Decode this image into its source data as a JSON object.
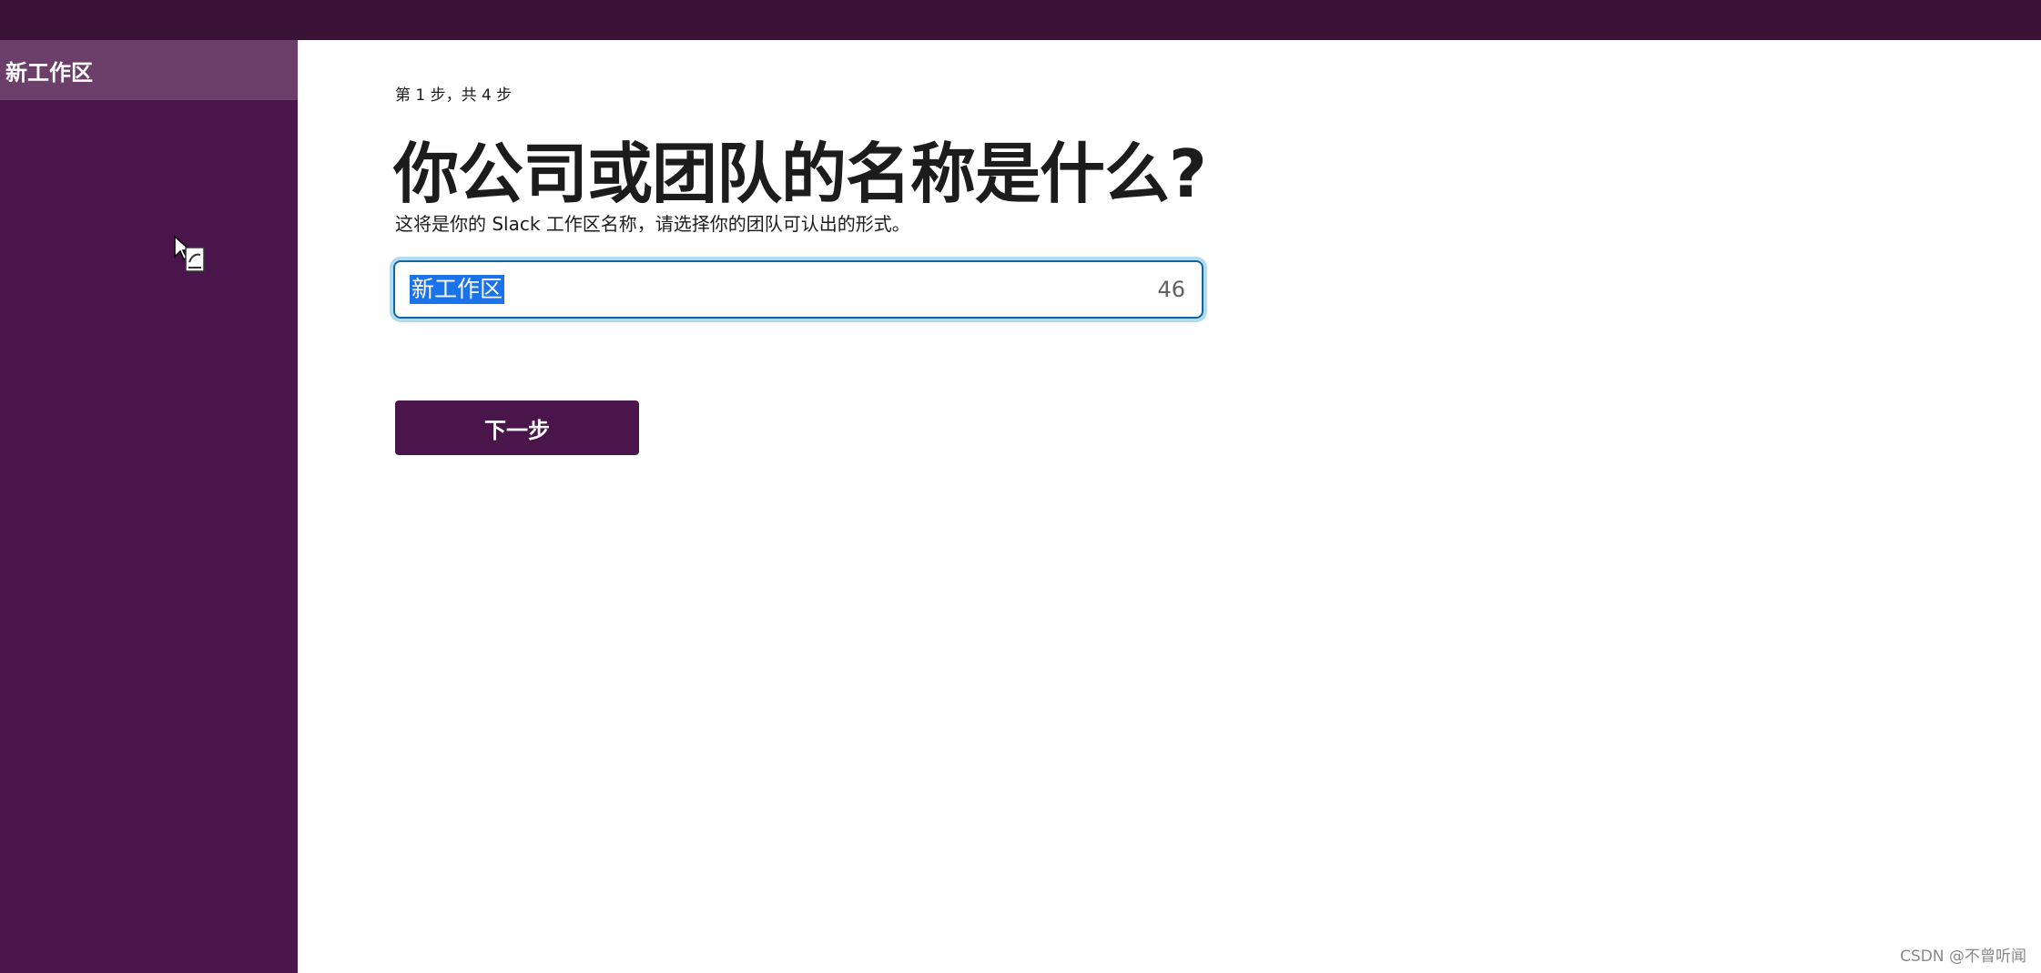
{
  "sidebar": {
    "workspace_name": "新工作区"
  },
  "main": {
    "step_text": "第 1 步，共 4 步",
    "heading": "你公司或团队的名称是什么?",
    "subtitle": "这将是你的 Slack 工作区名称，请选择你的团队可认出的形式。",
    "input": {
      "value": "新工作区",
      "remaining_count": "46"
    },
    "next_button_label": "下一步"
  },
  "watermark": "CSDN @不曾听闻",
  "colors": {
    "topbar": "#3b1237",
    "sidebar": "#4a154b",
    "sidebar_active": "#6b3f6a",
    "button": "#4a154b",
    "focus_border": "#1264a3",
    "selection": "#1a73e8"
  },
  "icons": {
    "cursor": "mouse-pointer-icon"
  }
}
